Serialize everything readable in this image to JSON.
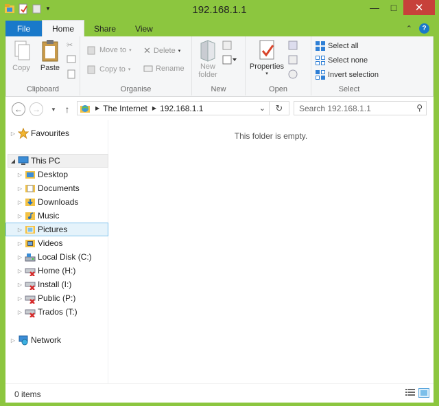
{
  "window": {
    "title": "192.168.1.1"
  },
  "title_buttons": {
    "minimize": "—",
    "maximize": "□",
    "close": "✕"
  },
  "tabs": {
    "file": "File",
    "home": "Home",
    "share": "Share",
    "view": "View"
  },
  "ribbon": {
    "clipboard": {
      "label": "Clipboard",
      "copy": "Copy",
      "paste": "Paste"
    },
    "organise": {
      "label": "Organise",
      "move_to": "Move to",
      "copy_to": "Copy to",
      "delete": "Delete",
      "rename": "Rename"
    },
    "new": {
      "label": "New",
      "new_folder_line1": "New",
      "new_folder_line2": "folder"
    },
    "open": {
      "label": "Open",
      "properties": "Properties"
    },
    "select": {
      "label": "Select",
      "select_all": "Select all",
      "select_none": "Select none",
      "invert": "Invert selection"
    }
  },
  "address": {
    "crumbs": [
      "The Internet",
      "192.168.1.1"
    ]
  },
  "search": {
    "placeholder": "Search 192.168.1.1"
  },
  "tree": {
    "favourites": "Favourites",
    "this_pc": "This PC",
    "desktop": "Desktop",
    "documents": "Documents",
    "downloads": "Downloads",
    "music": "Music",
    "pictures": "Pictures",
    "videos": "Videos",
    "local_disk": "Local Disk (C:)",
    "home": "Home (H:)",
    "install": "Install (I:)",
    "public": "Public (P:)",
    "trados": "Trados (T:)",
    "network": "Network"
  },
  "main": {
    "empty_message": "This folder is empty."
  },
  "status": {
    "items": "0 items"
  },
  "colors": {
    "frame": "#8cc63f",
    "file_tab": "#1979ca",
    "close_button": "#c7413a",
    "selection": "#e5f3fb"
  }
}
